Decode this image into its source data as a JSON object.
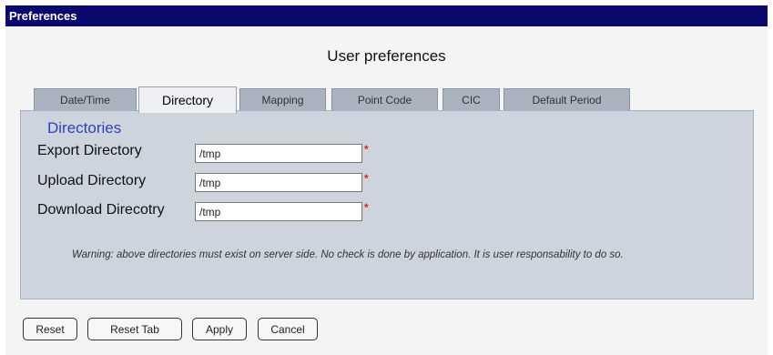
{
  "window": {
    "title": "Preferences"
  },
  "page": {
    "heading": "User preferences"
  },
  "tabs": [
    {
      "label": "Date/Time",
      "active": false
    },
    {
      "label": "Directory",
      "active": true
    },
    {
      "label": "Mapping",
      "active": false
    },
    {
      "label": "Point Code",
      "active": false
    },
    {
      "label": "CIC",
      "active": false
    },
    {
      "label": "Default Period",
      "active": false
    }
  ],
  "directories": {
    "section_title": "Directories",
    "fields": [
      {
        "label": "Export Directory",
        "value": "/tmp",
        "required_mark": "*"
      },
      {
        "label": "Upload Directory",
        "value": "/tmp",
        "required_mark": "*"
      },
      {
        "label": "Download Direcotry",
        "value": "/tmp",
        "required_mark": "*"
      }
    ],
    "warning_label": "Warning:",
    "warning_text": " above directories must exist on server side. No check is done by application. It is user responsability to do so."
  },
  "buttons": {
    "reset": "Reset",
    "reset_tab": "Reset Tab",
    "apply": "Apply",
    "cancel": "Cancel"
  }
}
